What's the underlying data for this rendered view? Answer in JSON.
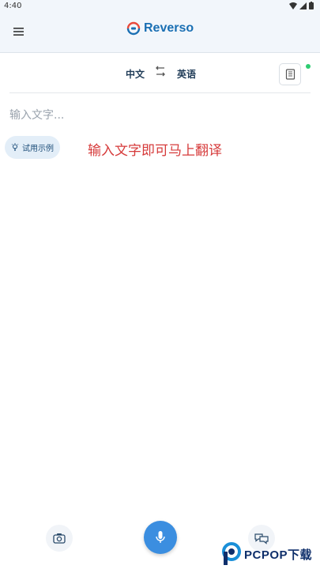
{
  "status_bar": {
    "time": "4:40"
  },
  "header": {
    "app_name": "Reverso"
  },
  "language_bar": {
    "source": "中文",
    "target": "英语"
  },
  "input": {
    "placeholder": "输入文字..."
  },
  "try_example": {
    "label": "试用示例"
  },
  "annotation": {
    "text": "输入文字即可马上翻译"
  },
  "watermark": {
    "brand": "PCPOP下载"
  },
  "colors": {
    "brand": "#1a6fb3",
    "mic": "#3b8ee0",
    "annotation": "#d63a3a",
    "online_dot": "#2ecc71"
  }
}
